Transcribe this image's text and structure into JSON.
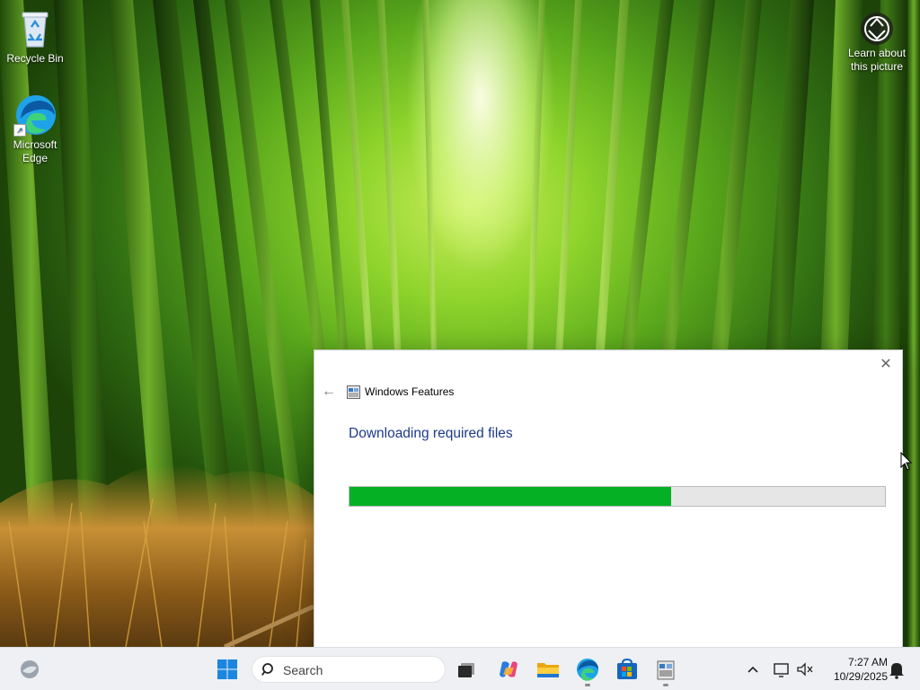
{
  "desktop": {
    "icons": [
      {
        "label": "Recycle Bin"
      },
      {
        "label": "Microsoft Edge"
      }
    ],
    "learn_about": "Learn about this picture"
  },
  "dialog": {
    "title": "Windows Features",
    "heading": "Downloading required files",
    "progress_percent": 60,
    "close_glyph": "✕",
    "back_glyph": "←"
  },
  "taskbar": {
    "search_placeholder": "Search",
    "apps": [
      "widgets-icon",
      "start-icon",
      "search-icon",
      "task-view-icon",
      "copilot-icon",
      "file-explorer-icon",
      "edge-icon",
      "store-icon",
      "windows-features-icon"
    ],
    "tray_icons": [
      "chevron-up-icon",
      "network-icon",
      "volume-muted-icon",
      "notification-icon"
    ],
    "time": "7:27 AM",
    "date": "10/29/2025"
  },
  "colors": {
    "progress_fill": "#06b025",
    "heading": "#1c3a87",
    "taskbar": "#eef0f3"
  }
}
